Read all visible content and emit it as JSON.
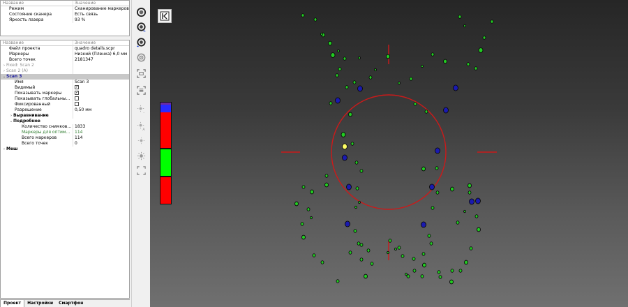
{
  "scanner_panel": {
    "header": {
      "name": "Название",
      "value": "Значение"
    },
    "rows": [
      {
        "name": "Режим",
        "value": "Сканирование маркеров"
      },
      {
        "name": "Состояние сканера",
        "value": "Есть связь"
      },
      {
        "name": "Яркость лазера",
        "value": "93 %"
      }
    ]
  },
  "project_panel": {
    "header": {
      "name": "Название",
      "value": "Значение"
    },
    "file_label": "Файл проекта",
    "file_value": "quadro details.scpr",
    "markers_label": "Маркеры",
    "markers_value": "Низкий (Пленка) 6,0 мм",
    "total_points_label": "Всего точек",
    "total_points_value": "2181347",
    "fixed_scan2": "Fixed: Scan 2",
    "scan2a": "Scan 2 (A)",
    "scan3": "Scan 3",
    "name_label": "Имя",
    "name_value": "Scan 3",
    "visible_label": "Видимый",
    "show_markers_label": "Показывать маркеры",
    "show_global_label": "Показывать глобальные указ...",
    "fixed_label": "Фиксированный",
    "resolution_label": "Разрешение",
    "resolution_value": "0,50 мм",
    "alignment_label": "Выравнивание",
    "details_label": "Подробнее",
    "shots_label": "Количество снимков опт...",
    "shots_value": "1833",
    "opt_markers_label": "Маркеры для оптимизации",
    "opt_markers_value": "114",
    "total_markers_label": "Всего маркеров",
    "total_markers_value": "114",
    "total_points2_label": "Всего точек",
    "total_points2_value": "0",
    "mesh_label": "Меш"
  },
  "tabs": [
    "Проект",
    "Настройки",
    "Смартфон"
  ],
  "toolbar_icons": [
    "scan-mode-icon",
    "rotate-marker-icon",
    "rotate-marker-alt-icon",
    "turntable-icon",
    "frame-select-icon",
    "layers-icon",
    "brightness-low-icon",
    "brightness-auto-icon",
    "brightness-dim-icon",
    "brightness-high-icon",
    "fit-view-icon"
  ],
  "scale_colors": {
    "red": "#ff0000",
    "green": "#00ff00",
    "blue": "#2a2aff",
    "purple": "#6a2aa0"
  },
  "viewport_colors": {
    "crosshair": "#cc1a1a",
    "marker_green": "#22cc22",
    "marker_blue": "#1a1ab0",
    "marker_yellow": "#ffff66"
  }
}
